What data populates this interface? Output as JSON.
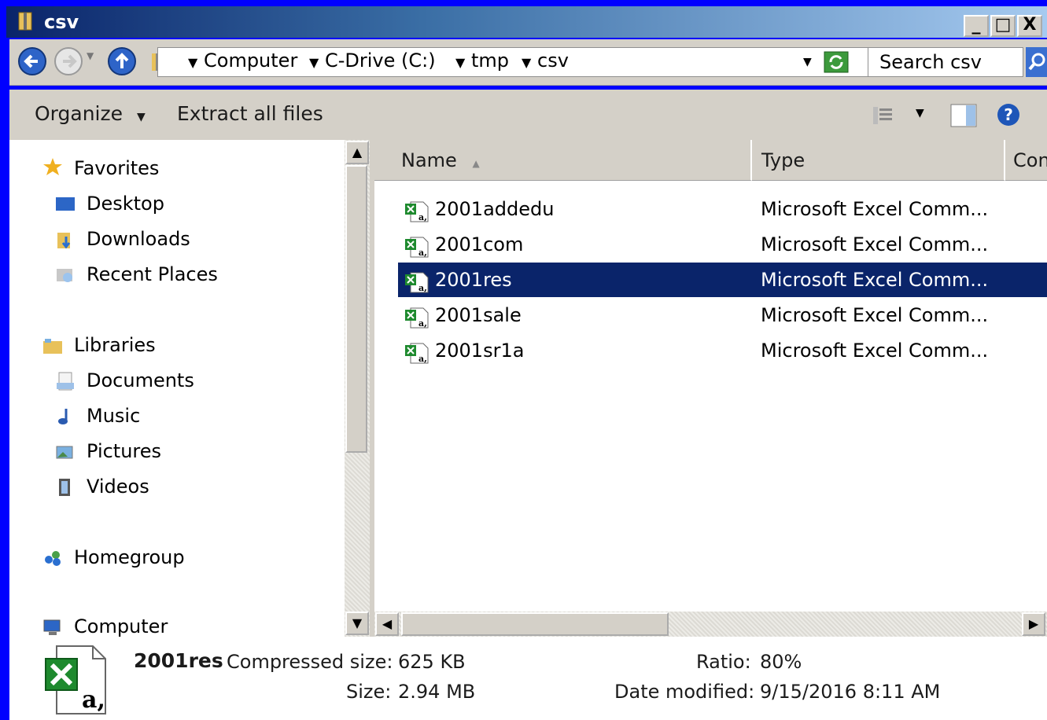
{
  "window": {
    "title": "csv"
  },
  "titlebar_buttons": {
    "minimize": "_",
    "maximize": "□",
    "close": "X"
  },
  "address": {
    "crumbs": [
      "Computer",
      "C-Drive (C:)",
      "tmp",
      "csv"
    ],
    "search_placeholder": "Search csv"
  },
  "toolbar": {
    "organize": "Organize",
    "extract": "Extract all files"
  },
  "nav": {
    "favorites": "Favorites",
    "desktop": "Desktop",
    "downloads": "Downloads",
    "recent": "Recent Places",
    "libraries": "Libraries",
    "documents": "Documents",
    "music": "Music",
    "pictures": "Pictures",
    "videos": "Videos",
    "homegroup": "Homegroup",
    "computer": "Computer"
  },
  "columns": {
    "name": "Name",
    "type": "Type",
    "compressed": "Con"
  },
  "files": [
    {
      "name": "2001addedu",
      "type": "Microsoft Excel Comm..."
    },
    {
      "name": "2001com",
      "type": "Microsoft Excel Comm..."
    },
    {
      "name": "2001res",
      "type": "Microsoft Excel Comm..."
    },
    {
      "name": "2001sale",
      "type": "Microsoft Excel Comm..."
    },
    {
      "name": "2001sr1a",
      "type": "Microsoft Excel Comm..."
    }
  ],
  "selected_index": 2,
  "details": {
    "name": "2001res",
    "compressed_label": "Compressed size:",
    "compressed_value": "625 KB",
    "size_label": "Size:",
    "size_value": "2.94 MB",
    "ratio_label": "Ratio:",
    "ratio_value": "80%",
    "date_label": "Date modified:",
    "date_value": "9/15/2016 8:11 AM"
  },
  "colors": {
    "selection": "#0a246a",
    "chrome": "#d4d0c8",
    "border": "#0000ff"
  }
}
